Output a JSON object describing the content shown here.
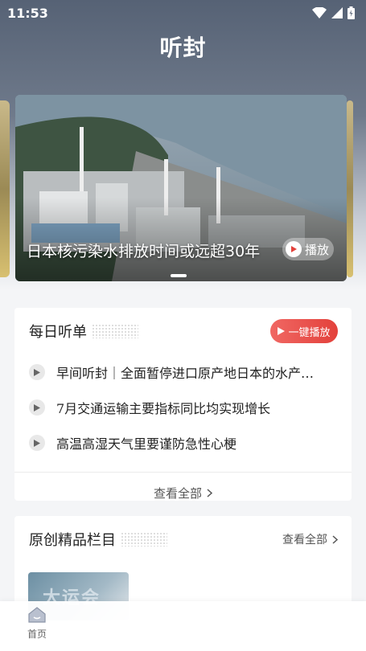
{
  "status_bar": {
    "time": "11:53"
  },
  "app": {
    "title": "听封"
  },
  "banner": {
    "caption": "日本核污染水排放时间或远超30年",
    "play_label": "播放"
  },
  "daily": {
    "title": "每日听单",
    "play_all_label": "一键播放",
    "items": [
      {
        "title": "早间听封｜全面暂停进口原产地日本的水产…"
      },
      {
        "title": "7月交通运输主要指标同比均实现增长"
      },
      {
        "title": "高温高湿天气里要谨防急性心梗"
      }
    ],
    "view_all_label": "查看全部"
  },
  "columns": {
    "title": "原创精品栏目",
    "view_all_label": "查看全部"
  },
  "tabbar": {
    "home_label": "首页"
  },
  "colors": {
    "accent": "#e3413b",
    "header": "#566275"
  }
}
